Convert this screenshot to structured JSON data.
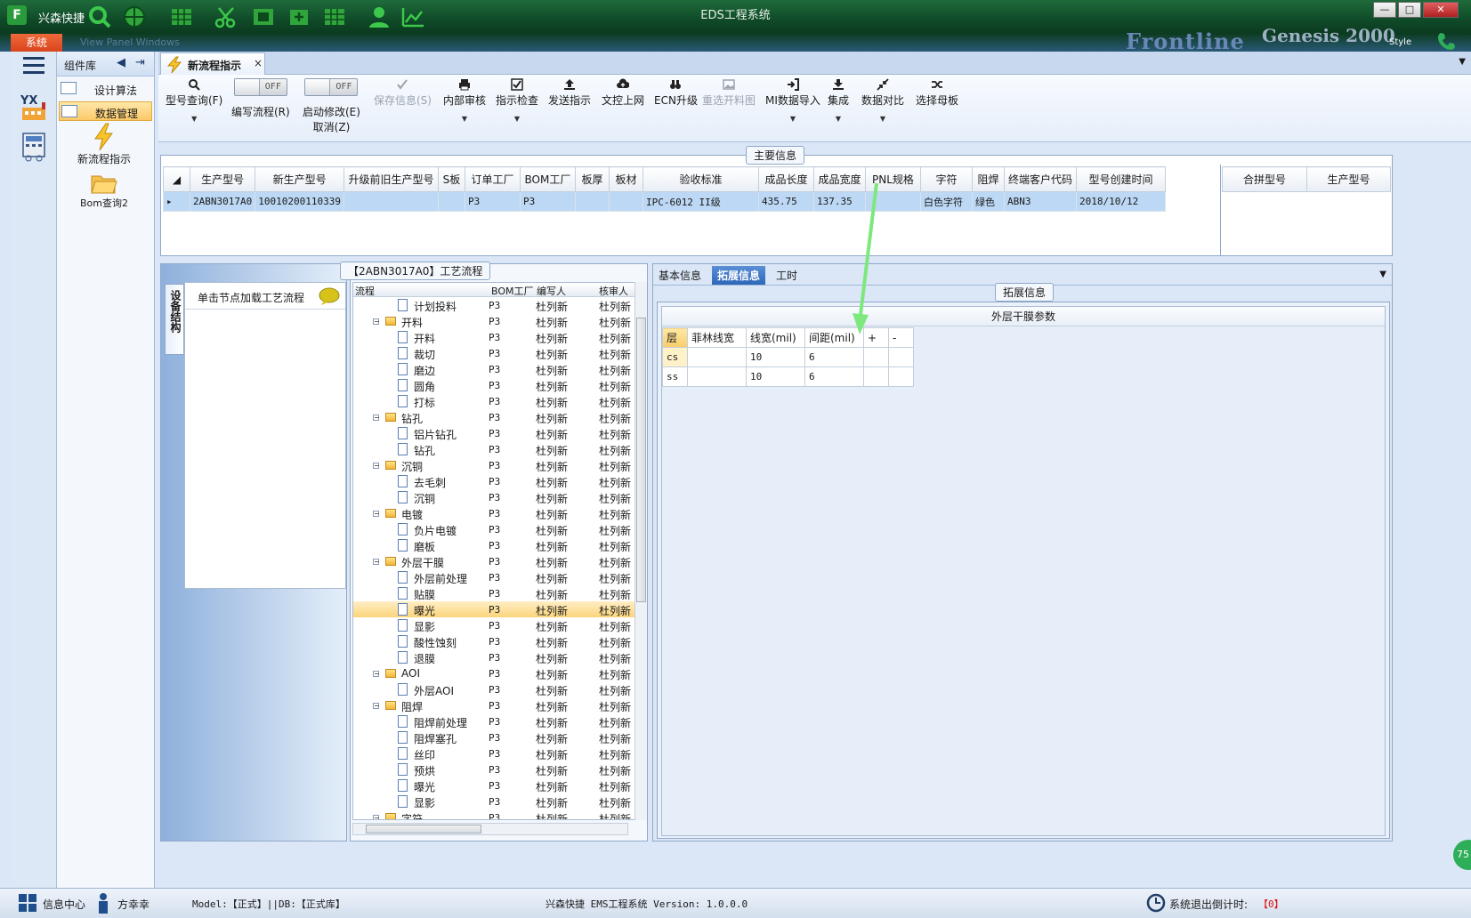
{
  "app": {
    "name": "兴森快捷",
    "window_title": "EDS工程系统",
    "banner_left": "View  Panel  Windows",
    "banner_brand": "Frontline",
    "banner_brand2": "Genesis 2000",
    "style_label": "Style",
    "system_tab": "系统"
  },
  "window_buttons": {
    "min": "—",
    "max": "□",
    "close": "✕"
  },
  "component_panel": {
    "title": "组件库",
    "items": [
      {
        "label": "设计算法",
        "selected": false
      },
      {
        "label": "数据管理",
        "selected": true
      }
    ],
    "big_items": [
      {
        "label": "新流程指示",
        "icon": "lightning-icon"
      },
      {
        "label": "Bom查询2",
        "icon": "open-folder-icon"
      }
    ]
  },
  "doc_tab": {
    "label": "新流程指示",
    "close": "×"
  },
  "ribbon": {
    "model_query": "型号查询(F)",
    "write_flow": "编写流程(R)",
    "edit_cancel_1": "启动修改(E)",
    "edit_cancel_2": "取消(Z)",
    "toggle_off": "OFF",
    "save_info": "保存信息(S)",
    "internal_review": "内部审核",
    "instr_check": "指示检查",
    "send_instr": "发送指示",
    "doc_upload": "文控上网",
    "ecn_upgrade": "ECN升级",
    "reselect_chart": "重选开料图",
    "mi_import": "MI数据导入",
    "integrate": "集成",
    "data_compare": "数据对比",
    "select_master": "选择母板"
  },
  "main_info": {
    "group_label": "主要信息",
    "columns": [
      "生产型号",
      "新生产型号",
      "升级前旧生产型号",
      "S板",
      "订单工厂",
      "BOM工厂",
      "板厚",
      "板材",
      "验收标准",
      "成品长度",
      "成品宽度",
      "PNL规格",
      "字符",
      "阻焊",
      "终端客户代码",
      "型号创建时间"
    ],
    "row": [
      "2ABN3017A0",
      "10010200110339",
      "",
      "",
      "P3",
      "P3",
      "",
      "",
      "IPC-6012 II级",
      "435.75",
      "137.35",
      "",
      "白色字符",
      "绿色",
      "ABN3",
      "2018/10/12"
    ],
    "side_columns": [
      "合拼型号",
      "生产型号"
    ]
  },
  "left_pane": {
    "vertical_tab": "设备结构",
    "load_hint": "单击节点加载工艺流程"
  },
  "flow": {
    "group_label": "【2ABN3017A0】工艺流程",
    "headers": [
      "流程",
      "BOM工厂",
      "编写人",
      "核审人"
    ],
    "rows": [
      {
        "name": "计划投料",
        "level": 1,
        "type": "doc",
        "bom": "P3",
        "writer": "杜列新",
        "reviewer": "杜列新"
      },
      {
        "name": "开料",
        "level": 0,
        "type": "folder",
        "bom": "P3",
        "writer": "杜列新",
        "reviewer": "杜列新"
      },
      {
        "name": "开料",
        "level": 1,
        "type": "doc",
        "bom": "P3",
        "writer": "杜列新",
        "reviewer": "杜列新"
      },
      {
        "name": "裁切",
        "level": 1,
        "type": "doc",
        "bom": "P3",
        "writer": "杜列新",
        "reviewer": "杜列新"
      },
      {
        "name": "磨边",
        "level": 1,
        "type": "doc",
        "bom": "P3",
        "writer": "杜列新",
        "reviewer": "杜列新"
      },
      {
        "name": "圆角",
        "level": 1,
        "type": "doc",
        "bom": "P3",
        "writer": "杜列新",
        "reviewer": "杜列新"
      },
      {
        "name": "打标",
        "level": 1,
        "type": "doc",
        "bom": "P3",
        "writer": "杜列新",
        "reviewer": "杜列新"
      },
      {
        "name": "钻孔",
        "level": 0,
        "type": "folder",
        "bom": "P3",
        "writer": "杜列新",
        "reviewer": "杜列新"
      },
      {
        "name": "铝片钻孔",
        "level": 1,
        "type": "doc",
        "bom": "P3",
        "writer": "杜列新",
        "reviewer": "杜列新"
      },
      {
        "name": "钻孔",
        "level": 1,
        "type": "doc",
        "bom": "P3",
        "writer": "杜列新",
        "reviewer": "杜列新"
      },
      {
        "name": "沉铜",
        "level": 0,
        "type": "folder",
        "bom": "P3",
        "writer": "杜列新",
        "reviewer": "杜列新"
      },
      {
        "name": "去毛刺",
        "level": 1,
        "type": "doc",
        "bom": "P3",
        "writer": "杜列新",
        "reviewer": "杜列新"
      },
      {
        "name": "沉铜",
        "level": 1,
        "type": "doc",
        "bom": "P3",
        "writer": "杜列新",
        "reviewer": "杜列新"
      },
      {
        "name": "电镀",
        "level": 0,
        "type": "folder",
        "bom": "P3",
        "writer": "杜列新",
        "reviewer": "杜列新"
      },
      {
        "name": "负片电镀",
        "level": 1,
        "type": "doc",
        "bom": "P3",
        "writer": "杜列新",
        "reviewer": "杜列新"
      },
      {
        "name": "磨板",
        "level": 1,
        "type": "doc",
        "bom": "P3",
        "writer": "杜列新",
        "reviewer": "杜列新"
      },
      {
        "name": "外层干膜",
        "level": 0,
        "type": "folder",
        "bom": "P3",
        "writer": "杜列新",
        "reviewer": "杜列新"
      },
      {
        "name": "外层前处理",
        "level": 1,
        "type": "doc",
        "bom": "P3",
        "writer": "杜列新",
        "reviewer": "杜列新"
      },
      {
        "name": "贴膜",
        "level": 1,
        "type": "doc",
        "bom": "P3",
        "writer": "杜列新",
        "reviewer": "杜列新"
      },
      {
        "name": "曝光",
        "level": 1,
        "type": "doc",
        "bom": "P3",
        "writer": "杜列新",
        "reviewer": "杜列新",
        "selected": true
      },
      {
        "name": "显影",
        "level": 1,
        "type": "doc",
        "bom": "P3",
        "writer": "杜列新",
        "reviewer": "杜列新"
      },
      {
        "name": "酸性蚀刻",
        "level": 1,
        "type": "doc",
        "bom": "P3",
        "writer": "杜列新",
        "reviewer": "杜列新"
      },
      {
        "name": "退膜",
        "level": 1,
        "type": "doc",
        "bom": "P3",
        "writer": "杜列新",
        "reviewer": "杜列新"
      },
      {
        "name": "AOI",
        "level": 0,
        "type": "folder",
        "bom": "P3",
        "writer": "杜列新",
        "reviewer": "杜列新"
      },
      {
        "name": "外层AOI",
        "level": 1,
        "type": "doc",
        "bom": "P3",
        "writer": "杜列新",
        "reviewer": "杜列新"
      },
      {
        "name": "阻焊",
        "level": 0,
        "type": "folder",
        "bom": "P3",
        "writer": "杜列新",
        "reviewer": "杜列新"
      },
      {
        "name": "阻焊前处理",
        "level": 1,
        "type": "doc",
        "bom": "P3",
        "writer": "杜列新",
        "reviewer": "杜列新"
      },
      {
        "name": "阻焊塞孔",
        "level": 1,
        "type": "doc",
        "bom": "P3",
        "writer": "杜列新",
        "reviewer": "杜列新"
      },
      {
        "name": "丝印",
        "level": 1,
        "type": "doc",
        "bom": "P3",
        "writer": "杜列新",
        "reviewer": "杜列新"
      },
      {
        "name": "预烘",
        "level": 1,
        "type": "doc",
        "bom": "P3",
        "writer": "杜列新",
        "reviewer": "杜列新"
      },
      {
        "name": "曝光",
        "level": 1,
        "type": "doc",
        "bom": "P3",
        "writer": "杜列新",
        "reviewer": "杜列新"
      },
      {
        "name": "显影",
        "level": 1,
        "type": "doc",
        "bom": "P3",
        "writer": "杜列新",
        "reviewer": "杜列新"
      },
      {
        "name": "字符",
        "level": 0,
        "type": "folder",
        "bom": "P3",
        "writer": "杜列新",
        "reviewer": "杜列新"
      }
    ]
  },
  "right_pane": {
    "tabs": [
      "基本信息",
      "拓展信息",
      "工时"
    ],
    "active_tab": 1,
    "group_label": "拓展信息",
    "table_title": "外层干膜参数",
    "columns": [
      "层",
      "菲林线宽",
      "线宽(mil)",
      "间距(mil)",
      "+",
      "-"
    ],
    "rows": [
      [
        "cs",
        "",
        "10",
        "6",
        "",
        ""
      ],
      [
        "ss",
        "",
        "10",
        "6",
        "",
        ""
      ]
    ]
  },
  "status": {
    "info_center": "信息中心",
    "user": "方幸幸",
    "model_db": "Model:【正式】||DB:【正式库】",
    "version": "兴森快捷 EMS工程系统 Version: 1.0.0.0",
    "countdown_label": "系统退出倒计时:",
    "countdown_value": "【0】",
    "badge": "75"
  },
  "colors": {
    "accent": "#2e66b8",
    "selection": "#fbd57c",
    "title_bar": "#0f4a28",
    "annotation_arrow": "#7ee87e"
  }
}
